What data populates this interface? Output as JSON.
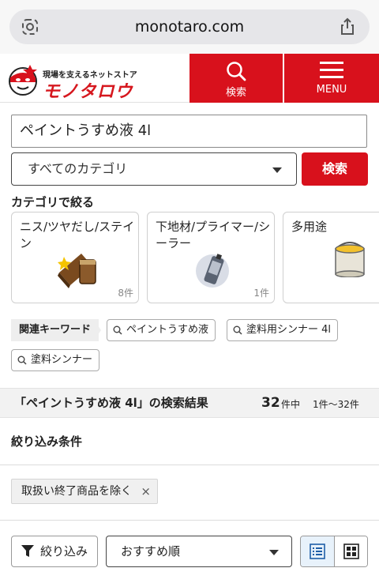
{
  "browser": {
    "url": "monotaro.com",
    "left_icon": "camera-lens-icon",
    "right_icon": "share-icon"
  },
  "header": {
    "tagline": "現場を支えるネットストア",
    "brand": "モノタロウ",
    "search_label": "検索",
    "menu_label": "MENU",
    "brand_color": "#d8111c"
  },
  "search": {
    "query": "ペイントうすめ液 4l",
    "category_value": "すべてのカテゴリ",
    "button_label": "検索"
  },
  "category_section": {
    "title": "カテゴリで絞る",
    "cards": [
      {
        "name": "ニス/ツヤだし/ステイン",
        "count": "8件",
        "icon": "varnish-can-icon"
      },
      {
        "name": "下地材/プライマー/シーラー",
        "count": "1件",
        "icon": "primer-spray-can-icon"
      },
      {
        "name": "多用途",
        "count": "",
        "icon": "paint-can-icon"
      }
    ]
  },
  "keywords": {
    "label": "関連キーワード",
    "chips": [
      "ペイントうすめ液",
      "塗料用シンナー 4l",
      "塗料シンナー"
    ]
  },
  "results": {
    "title": "「ペイントうすめ液 4l」の検索結果",
    "count": "32",
    "count_unit": "件中",
    "range": "1件〜32件"
  },
  "filters": {
    "heading": "絞り込み条件",
    "active_chip": "取扱い終了商品を除く",
    "remove_symbol": "×"
  },
  "controls": {
    "narrow_label": "絞り込み",
    "sort_value": "おすすめ順",
    "view_modes": [
      "list-view-icon",
      "grid-view-icon"
    ],
    "active_view": "list"
  }
}
